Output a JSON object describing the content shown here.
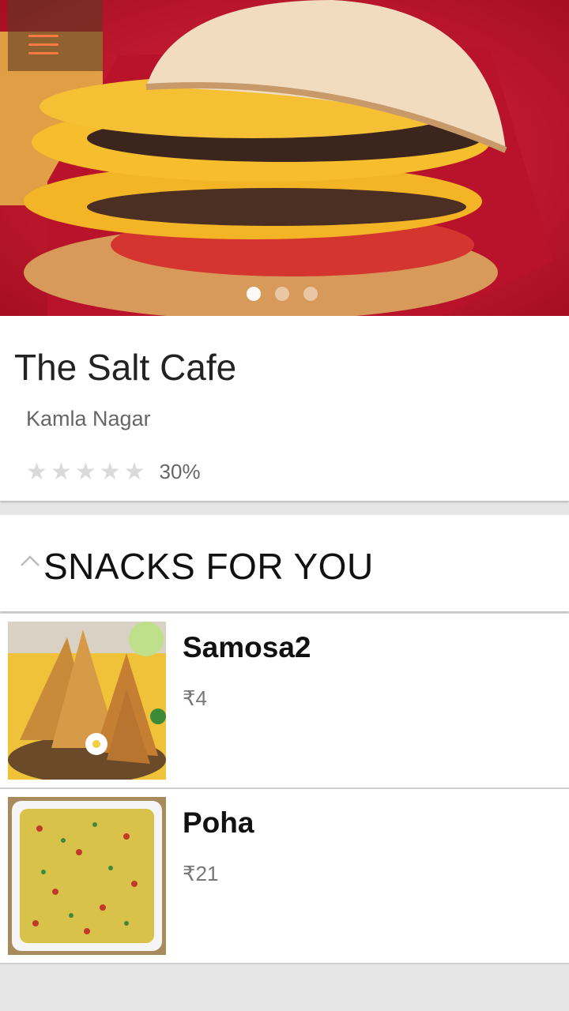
{
  "hero": {
    "image": "burger-photo",
    "slides": 3,
    "active_slide": 1
  },
  "icons": {
    "menu": "hamburger-menu-icon",
    "collapse": "chevron-up-icon",
    "rating": "star-icon"
  },
  "colors": {
    "menu_accent": "#ff7a45",
    "hero_background": "#c4122a"
  },
  "restaurant": {
    "name": "The Salt Cafe",
    "location": "Kamla Nagar",
    "rating_stars": 0,
    "rating_max": 5,
    "discount": "30%"
  },
  "section": {
    "title": "SNACKS FOR YOU"
  },
  "items": [
    {
      "name": "Samosa2",
      "price": "₹4",
      "image": "samosa-photo"
    },
    {
      "name": "Poha",
      "price": "₹21",
      "image": "poha-photo"
    }
  ]
}
